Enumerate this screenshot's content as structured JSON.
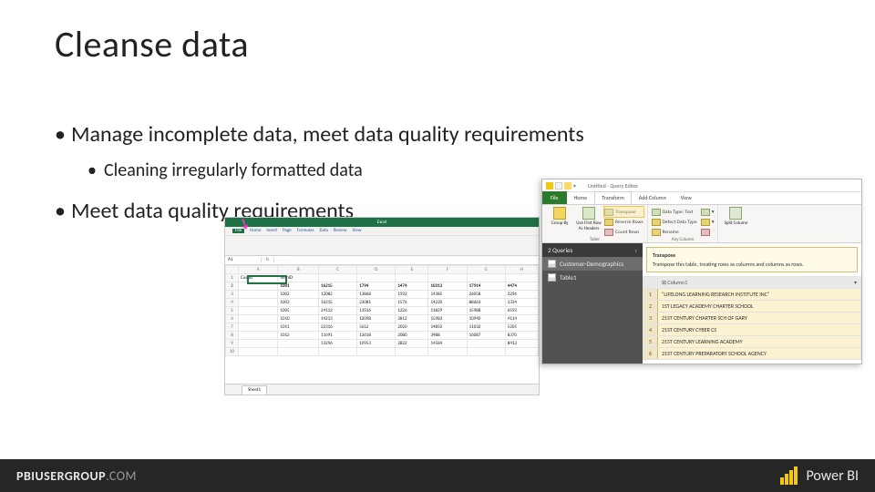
{
  "title": "Cleanse data",
  "bullets": {
    "b1": "Manage incomplete data, meet data quality requirements",
    "b2": "Cleaning irregularly formatted data",
    "b3": "Meet data quality requirements"
  },
  "excel": {
    "title": "Excel",
    "menu": [
      "File",
      "Home",
      "Insert",
      "Page",
      "Formulas",
      "Data",
      "Review",
      "View"
    ],
    "namebox": "A1",
    "fx": "fx",
    "sheet_tab": "Sheet1",
    "headers": [
      "",
      "A",
      "B",
      "C",
      "D",
      "E",
      "F",
      "G",
      "H"
    ],
    "rows": [
      [
        "1",
        "CustID",
        "ItemID",
        "",
        "",
        "",
        "",
        "",
        ""
      ],
      [
        "2",
        "",
        "1001",
        "16215",
        "1794",
        "1474",
        "10313",
        "17914",
        "4474"
      ],
      [
        "3",
        "",
        "1002",
        "12082",
        "13868",
        "1932",
        "14385",
        "26058",
        "2296"
      ],
      [
        "4",
        "",
        "1003",
        "16215",
        "23081",
        "1576",
        "14220",
        "88663",
        "3334"
      ],
      [
        "5",
        "",
        "1005",
        "24112",
        "13516",
        "1226",
        "11829",
        "15988",
        "6593"
      ],
      [
        "6",
        "",
        "1010",
        "14213",
        "12098",
        "2812",
        "15983",
        "10940",
        "4114"
      ],
      [
        "7",
        "",
        "1011",
        "22316",
        "5612",
        "2020",
        "14850",
        "11032",
        "5205"
      ],
      [
        "8",
        "",
        "1012",
        "11691",
        "13618",
        "2080",
        "3488",
        "16087",
        "8370"
      ],
      [
        "9",
        "",
        "",
        "13296",
        "10953",
        "2822",
        "14584",
        "",
        "8413"
      ],
      [
        "10",
        "",
        "",
        "",
        "",
        "",
        "",
        "",
        ""
      ]
    ]
  },
  "pq": {
    "title": "Untitled - Query Editor",
    "tabs": [
      "File",
      "Home",
      "Transform",
      "Add Column",
      "View"
    ],
    "active_tab": "Transform",
    "ribbon": {
      "group_by": "Group\nBy",
      "first_row": "Use First Row\nAs Headers",
      "table_label": "Table",
      "transpose": "Transpose",
      "reverse": "Reverse Rows",
      "count": "Count Rows",
      "dtype": "Data Type: Text",
      "detect": "Detect Data Type",
      "rename": "Rename",
      "anycol_label": "Any Column",
      "split": "Split\nColumn"
    },
    "tooltip": {
      "title": "Transpose",
      "body": "Transpose this table, treating rows as columns and columns as rows."
    },
    "sidebar": {
      "header": "2 Queries",
      "items": [
        "Customer-Demographics",
        "Table1"
      ]
    },
    "colheader": "Column1",
    "rows": [
      "\"LIFELONG LEARNING RESEARCH INSTITUTE INC\"",
      "1ST LEGACY ACADEMY CHARTER SCHOOL",
      "21ST CENTURY CHARTER SCH OF GARY",
      "21ST CENTURY CYBER CS",
      "21ST CENTURY LEARNING ACADEMY",
      "21ST CENTURY PREPARATORY SCHOOL AGENCY"
    ]
  },
  "footer": {
    "brand_bold": "PBIUSERGROUP",
    "brand_tld": ".COM",
    "product": "Power BI"
  }
}
